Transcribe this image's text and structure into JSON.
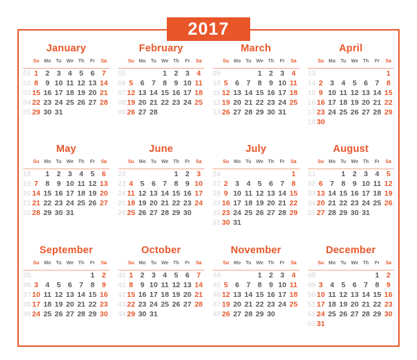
{
  "title": "2017",
  "theme": {
    "accent": "#e8562a",
    "weekday_text": "#58585a",
    "weeknum_text": "#e3e3e3",
    "header_rule": "#f0a68c"
  },
  "weekday_headers": [
    "Su",
    "Mo",
    "Tu",
    "We",
    "Th",
    "Fr",
    "Sa"
  ],
  "months": [
    {
      "name": "January",
      "week_numbers": [
        "01",
        "02",
        "03",
        "04",
        "05"
      ],
      "weeks": [
        [
          "1",
          "2",
          "3",
          "4",
          "5",
          "6",
          "7"
        ],
        [
          "8",
          "9",
          "10",
          "11",
          "12",
          "13",
          "14"
        ],
        [
          "15",
          "16",
          "17",
          "18",
          "19",
          "20",
          "21"
        ],
        [
          "22",
          "23",
          "24",
          "25",
          "26",
          "27",
          "28"
        ],
        [
          "29",
          "30",
          "31",
          "",
          "",
          "",
          ""
        ]
      ]
    },
    {
      "name": "February",
      "week_numbers": [
        "05",
        "06",
        "07",
        "08",
        "09"
      ],
      "weeks": [
        [
          "",
          "",
          "",
          "1",
          "2",
          "3",
          "4"
        ],
        [
          "5",
          "6",
          "7",
          "8",
          "9",
          "10",
          "11"
        ],
        [
          "12",
          "13",
          "14",
          "15",
          "16",
          "17",
          "18"
        ],
        [
          "19",
          "20",
          "21",
          "22",
          "23",
          "24",
          "25"
        ],
        [
          "26",
          "27",
          "28",
          "",
          "",
          "",
          ""
        ]
      ]
    },
    {
      "name": "March",
      "week_numbers": [
        "09",
        "10",
        "11",
        "12",
        "13"
      ],
      "weeks": [
        [
          "",
          "",
          "",
          "1",
          "2",
          "3",
          "4"
        ],
        [
          "5",
          "6",
          "7",
          "8",
          "9",
          "10",
          "11"
        ],
        [
          "12",
          "13",
          "14",
          "15",
          "16",
          "17",
          "18"
        ],
        [
          "19",
          "20",
          "21",
          "22",
          "23",
          "24",
          "25"
        ],
        [
          "26",
          "27",
          "28",
          "29",
          "30",
          "31",
          ""
        ]
      ]
    },
    {
      "name": "April",
      "week_numbers": [
        "13",
        "14",
        "15",
        "16",
        "17",
        "18"
      ],
      "weeks": [
        [
          "",
          "",
          "",
          "",
          "",
          "",
          "1"
        ],
        [
          "2",
          "3",
          "4",
          "5",
          "6",
          "7",
          "8"
        ],
        [
          "9",
          "10",
          "11",
          "12",
          "13",
          "14",
          "15"
        ],
        [
          "16",
          "17",
          "18",
          "19",
          "20",
          "21",
          "22"
        ],
        [
          "23",
          "24",
          "25",
          "26",
          "27",
          "28",
          "29"
        ],
        [
          "30",
          "",
          "",
          "",
          "",
          "",
          ""
        ]
      ]
    },
    {
      "name": "May",
      "week_numbers": [
        "18",
        "19",
        "20",
        "21",
        "22"
      ],
      "weeks": [
        [
          "",
          "1",
          "2",
          "3",
          "4",
          "5",
          "6"
        ],
        [
          "7",
          "8",
          "9",
          "10",
          "11",
          "12",
          "13"
        ],
        [
          "14",
          "15",
          "16",
          "17",
          "18",
          "19",
          "20"
        ],
        [
          "21",
          "22",
          "23",
          "24",
          "25",
          "26",
          "27"
        ],
        [
          "28",
          "29",
          "30",
          "31",
          "",
          "",
          ""
        ]
      ]
    },
    {
      "name": "June",
      "week_numbers": [
        "22",
        "23",
        "24",
        "25",
        "26"
      ],
      "weeks": [
        [
          "",
          "",
          "",
          "",
          "1",
          "2",
          "3"
        ],
        [
          "4",
          "5",
          "6",
          "7",
          "8",
          "9",
          "10"
        ],
        [
          "11",
          "12",
          "13",
          "14",
          "15",
          "16",
          "17"
        ],
        [
          "18",
          "19",
          "20",
          "21",
          "22",
          "23",
          "24"
        ],
        [
          "25",
          "26",
          "27",
          "28",
          "29",
          "30",
          ""
        ]
      ]
    },
    {
      "name": "July",
      "week_numbers": [
        "26",
        "27",
        "28",
        "29",
        "30",
        "31"
      ],
      "weeks": [
        [
          "",
          "",
          "",
          "",
          "",
          "",
          "1"
        ],
        [
          "2",
          "3",
          "4",
          "5",
          "6",
          "7",
          "8"
        ],
        [
          "9",
          "10",
          "11",
          "12",
          "13",
          "14",
          "15"
        ],
        [
          "16",
          "17",
          "18",
          "19",
          "20",
          "21",
          "22"
        ],
        [
          "23",
          "24",
          "25",
          "26",
          "27",
          "28",
          "29"
        ],
        [
          "30",
          "31",
          "",
          "",
          "",
          "",
          ""
        ]
      ]
    },
    {
      "name": "August",
      "week_numbers": [
        "31",
        "32",
        "33",
        "34",
        "35"
      ],
      "weeks": [
        [
          "",
          "",
          "1",
          "2",
          "3",
          "4",
          "5"
        ],
        [
          "6",
          "7",
          "8",
          "9",
          "10",
          "11",
          "12"
        ],
        [
          "13",
          "14",
          "15",
          "16",
          "17",
          "18",
          "19"
        ],
        [
          "20",
          "21",
          "22",
          "23",
          "24",
          "25",
          "26"
        ],
        [
          "27",
          "28",
          "29",
          "30",
          "31",
          "",
          ""
        ]
      ]
    },
    {
      "name": "September",
      "week_numbers": [
        "35",
        "36",
        "37",
        "38",
        "39"
      ],
      "weeks": [
        [
          "",
          "",
          "",
          "",
          "",
          "1",
          "2"
        ],
        [
          "3",
          "4",
          "5",
          "6",
          "7",
          "8",
          "9"
        ],
        [
          "10",
          "11",
          "12",
          "13",
          "14",
          "15",
          "16"
        ],
        [
          "17",
          "18",
          "19",
          "20",
          "21",
          "22",
          "23"
        ],
        [
          "24",
          "25",
          "26",
          "27",
          "28",
          "29",
          "30"
        ]
      ]
    },
    {
      "name": "October",
      "week_numbers": [
        "40",
        "41",
        "42",
        "43",
        "44"
      ],
      "weeks": [
        [
          "1",
          "2",
          "3",
          "4",
          "5",
          "6",
          "7"
        ],
        [
          "8",
          "9",
          "10",
          "11",
          "12",
          "13",
          "14"
        ],
        [
          "15",
          "16",
          "17",
          "18",
          "19",
          "20",
          "21"
        ],
        [
          "22",
          "23",
          "24",
          "25",
          "26",
          "27",
          "28"
        ],
        [
          "29",
          "30",
          "31",
          "",
          "",
          "",
          ""
        ]
      ]
    },
    {
      "name": "November",
      "week_numbers": [
        "44",
        "45",
        "46",
        "47",
        "48"
      ],
      "weeks": [
        [
          "",
          "",
          "",
          "1",
          "2",
          "3",
          "4"
        ],
        [
          "5",
          "6",
          "7",
          "8",
          "9",
          "10",
          "11"
        ],
        [
          "12",
          "13",
          "14",
          "15",
          "16",
          "17",
          "18"
        ],
        [
          "19",
          "20",
          "21",
          "22",
          "23",
          "24",
          "25"
        ],
        [
          "26",
          "27",
          "28",
          "29",
          "30",
          "",
          ""
        ]
      ]
    },
    {
      "name": "December",
      "week_numbers": [
        "48",
        "49",
        "50",
        "51",
        "52",
        "01"
      ],
      "weeks": [
        [
          "",
          "",
          "",
          "",
          "",
          "1",
          "2"
        ],
        [
          "3",
          "4",
          "5",
          "6",
          "7",
          "8",
          "9"
        ],
        [
          "10",
          "11",
          "12",
          "13",
          "14",
          "15",
          "16"
        ],
        [
          "17",
          "18",
          "19",
          "20",
          "21",
          "22",
          "23"
        ],
        [
          "24",
          "25",
          "26",
          "27",
          "28",
          "29",
          "30"
        ],
        [
          "31",
          "",
          "",
          "",
          "",
          "",
          ""
        ]
      ]
    }
  ]
}
